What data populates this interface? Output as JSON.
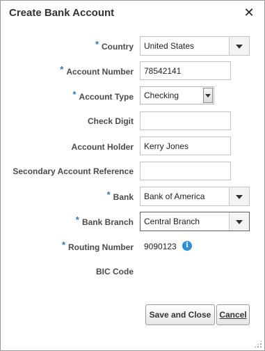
{
  "dialog": {
    "title": "Create Bank Account",
    "close_label": "✕",
    "required_marker": "*"
  },
  "fields": {
    "country": {
      "label": "Country",
      "required": true,
      "value": "United States"
    },
    "account_number": {
      "label": "Account Number",
      "required": true,
      "value": "78542141"
    },
    "account_type": {
      "label": "Account Type",
      "required": true,
      "value": "Checking"
    },
    "check_digit": {
      "label": "Check Digit",
      "required": false,
      "value": ""
    },
    "account_holder": {
      "label": "Account Holder",
      "required": false,
      "value": "Kerry Jones"
    },
    "secondary_account_reference": {
      "label": "Secondary Account Reference",
      "required": false,
      "value": ""
    },
    "bank": {
      "label": "Bank",
      "required": true,
      "value": "Bank of America"
    },
    "bank_branch": {
      "label": "Bank Branch",
      "required": true,
      "value": "Central Branch"
    },
    "routing_number": {
      "label": "Routing Number",
      "required": true,
      "value": "9090123"
    },
    "bic_code": {
      "label": "BIC Code",
      "required": false,
      "value": ""
    }
  },
  "buttons": {
    "save_and_close": "Save and Close",
    "cancel": "Cancel"
  },
  "icons": {
    "close": "close-icon",
    "info": "info-icon",
    "dropdown": "chevron-down-icon"
  },
  "colors": {
    "required_star": "#2e7ab5",
    "info_icon": "#2e8fd6"
  }
}
